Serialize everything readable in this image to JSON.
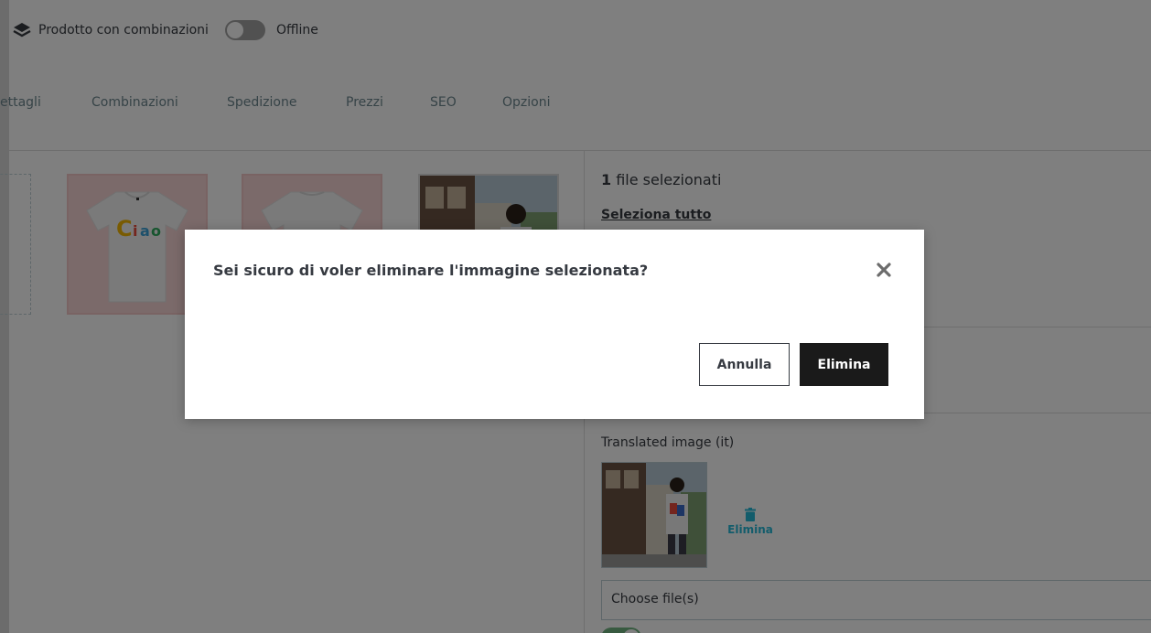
{
  "header": {
    "product_type_icon": "layers-icon",
    "product_type": "Prodotto con combinazioni",
    "status_toggle_state": "off",
    "status_label": "Offline"
  },
  "tabs": [
    {
      "label": "ettagli"
    },
    {
      "label": "Combinazioni"
    },
    {
      "label": "Spedizione"
    },
    {
      "label": "Prezzi"
    },
    {
      "label": "SEO"
    },
    {
      "label": "Opzioni"
    }
  ],
  "images": [
    {
      "name": "tshirt-ciao-front",
      "text": "Ciao"
    },
    {
      "name": "tshirt-back"
    },
    {
      "name": "photo-man-street"
    }
  ],
  "selection_panel": {
    "count": "1",
    "count_suffix": " file selezionati",
    "select_all": "Seleziona tutto",
    "translated_image_label": "Translated image (it)",
    "delete_icon": "trash-icon",
    "delete_label": "Elimina",
    "file_input_placeholder": "Choose file(s)",
    "cover_switch_state": "on"
  },
  "modal": {
    "title": "Sei sicuro di voler eliminare l'immagine selezionata?",
    "close_icon": "close-icon",
    "cancel_label": "Annulla",
    "confirm_label": "Elimina"
  },
  "colors": {
    "link": "#25b9d7",
    "primary_button": "#1a1a1a",
    "switch_on": "#70b580",
    "thumb_background": "#f7d4d4"
  }
}
